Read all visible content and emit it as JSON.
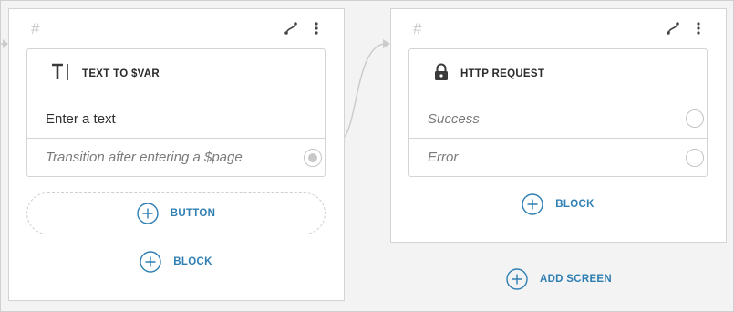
{
  "screens": [
    {
      "hash": "#",
      "block": {
        "title": "TEXT TO $VAR",
        "rows": [
          {
            "text": "Enter a text",
            "style": "plain"
          },
          {
            "text": "Transition after entering a $page",
            "style": "italic",
            "radio": "filled"
          }
        ]
      },
      "add_button_label": "BUTTON",
      "add_block_label": "BLOCK"
    },
    {
      "hash": "#",
      "block": {
        "title": "HTTP REQUEST",
        "rows": [
          {
            "text": "Success",
            "style": "italic",
            "radio": "empty"
          },
          {
            "text": "Error",
            "style": "italic",
            "radio": "empty"
          }
        ]
      },
      "add_block_label": "BLOCK"
    }
  ],
  "add_screen_label": "ADD SCREEN",
  "icons": {
    "connect": "route-connect-icon",
    "menu": "more-vertical-icon",
    "text_block": "text-cursor-icon",
    "http_block": "lock-icon",
    "add": "plus-circle-icon"
  },
  "colors": {
    "accent": "#2f7fb3",
    "canvas": "#f3f3f3",
    "card": "#ffffff",
    "border": "#d4d4d4",
    "connector": "#cccccc"
  }
}
